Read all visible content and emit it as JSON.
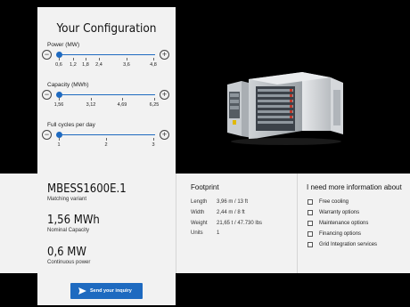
{
  "config": {
    "title": "Your Configuration",
    "sliders": [
      {
        "label": "Power (MW)",
        "ticks": [
          "0,6",
          "1,2",
          "1,8",
          "2,4",
          "3,6",
          "4,8"
        ],
        "selected": "0,6"
      },
      {
        "label": "Capacity (MWh)",
        "ticks": [
          "1,56",
          "3,12",
          "4,69",
          "6,25"
        ],
        "selected": "1,56"
      },
      {
        "label": "Full cycles per day",
        "ticks": [
          "1",
          "2",
          "3"
        ],
        "selected": "1"
      }
    ],
    "minus_symbol": "−",
    "plus_symbol": "+"
  },
  "result": {
    "variant": "MBESS1600E.1",
    "variant_caption": "Matching variant",
    "capacity": "1,56 MWh",
    "capacity_caption": "Nominal Capacity",
    "power": "0,6 MW",
    "power_caption": "Continuous power"
  },
  "footprint": {
    "title": "Footprint",
    "rows": [
      {
        "key": "Length",
        "value": "3,96 m / 13 ft"
      },
      {
        "key": "Width",
        "value": "2,44 m / 8 ft"
      },
      {
        "key": "Weight",
        "value": "21,65 t / 47.730 lbs"
      },
      {
        "key": "Units",
        "value": "1"
      }
    ]
  },
  "more_info": {
    "title": "I need more information about",
    "options": [
      "Free cooling",
      "Warranty options",
      "Maintenance options",
      "Financing options",
      "Grid Integration services"
    ]
  },
  "inquiry_button": {
    "label": "Send your inquiry"
  },
  "icons": {
    "send": "paper-plane-icon",
    "minus": "minus-circle-icon",
    "plus": "plus-circle-icon"
  },
  "colors": {
    "accent": "#1e6ac0",
    "panel": "#f2f2f2",
    "background": "#000000"
  }
}
